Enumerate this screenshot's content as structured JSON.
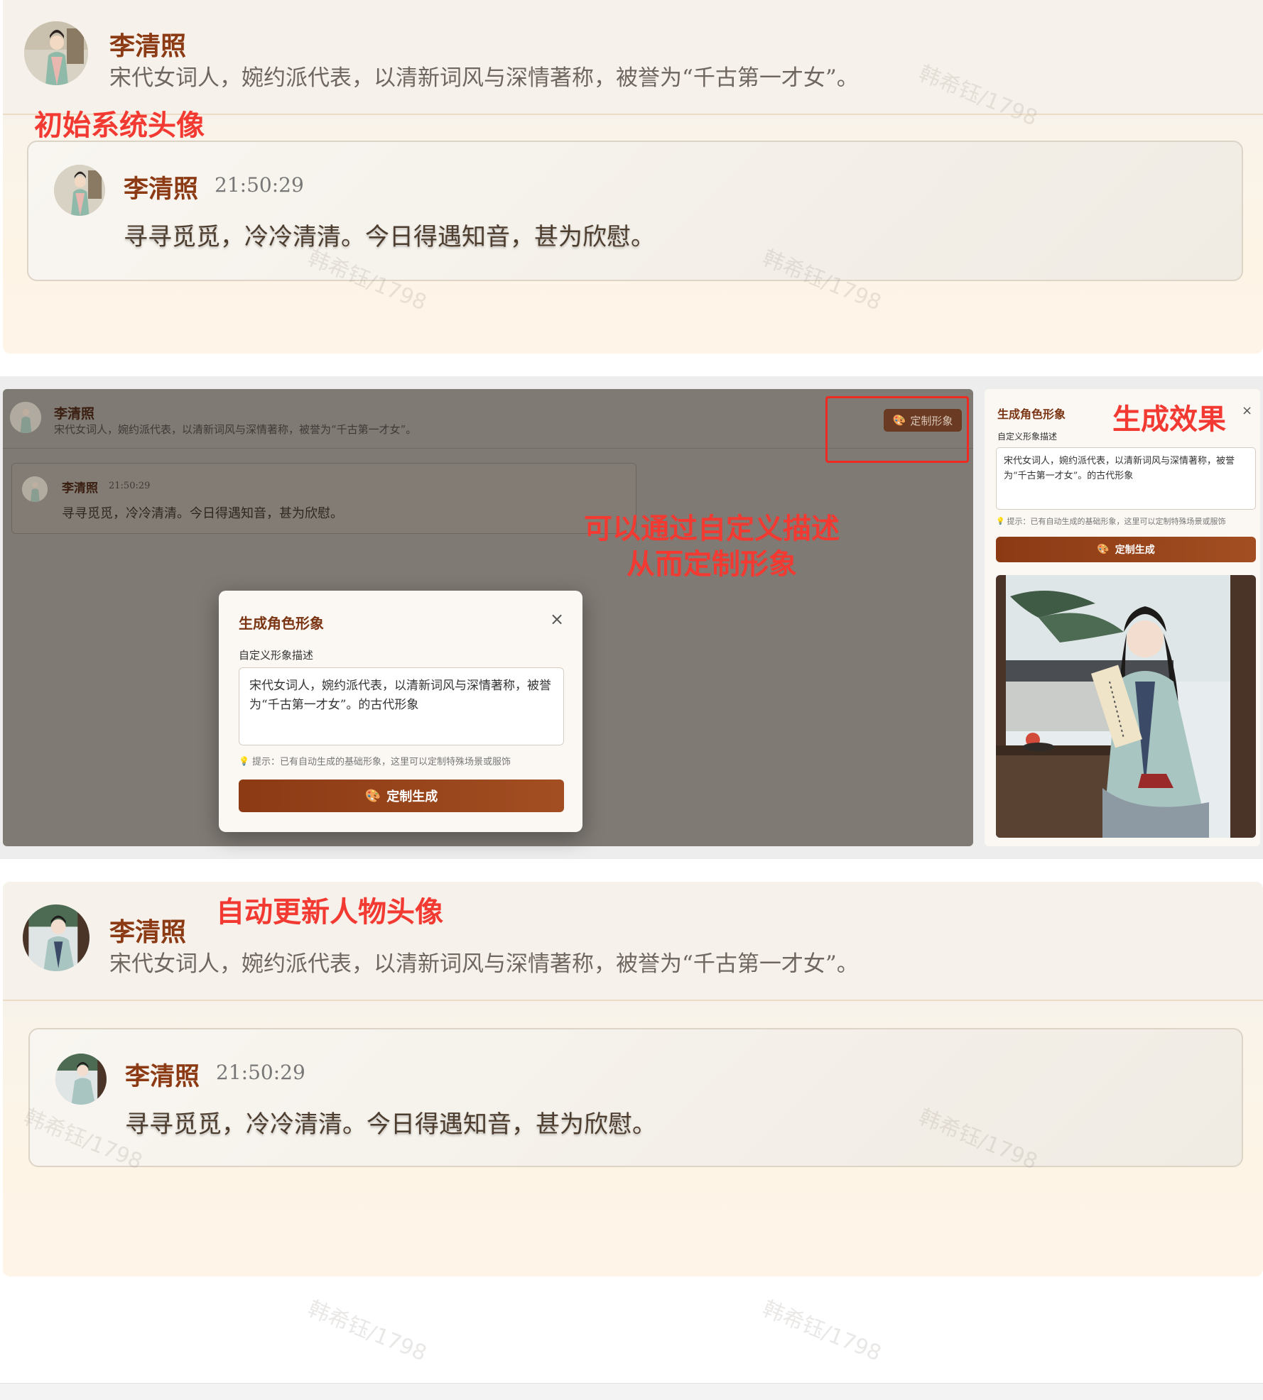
{
  "character": {
    "name": "李清照",
    "description": "宋代女词人，婉约派代表，以清新词风与深情著称，被誉为“千古第一才女”。"
  },
  "message": {
    "time": "21:50:29",
    "text": "寻寻觅觅，冷冷清清。今日得遇知音，甚为欣慰。"
  },
  "annotations": {
    "initial": "初始系统头像",
    "effect": "生成效果",
    "custom_line1": "可以通过自定义描述",
    "custom_line2": "从而定制形象",
    "auto_update": "自动更新人物头像"
  },
  "header_button": {
    "label": "定制形象",
    "icon": "palette-icon"
  },
  "modal": {
    "title": "生成角色形象",
    "close": "×",
    "label": "自定义形象描述",
    "textarea_value": "宋代女词人，婉约派代表，以清新词风与深情著称，被誉为“千古第一才女”。的古代形象",
    "hint": "提示：已有自动生成的基础形象，这里可以定制特殊场景或服饰",
    "hint_icon": "lightbulb-icon",
    "button": "定制生成",
    "button_icon": "palette-icon"
  },
  "watermark": "韩希钰/1798",
  "colors": {
    "accent": "#8b3a14",
    "annotation": "#f23a32",
    "overlay": "#7f7a74"
  }
}
